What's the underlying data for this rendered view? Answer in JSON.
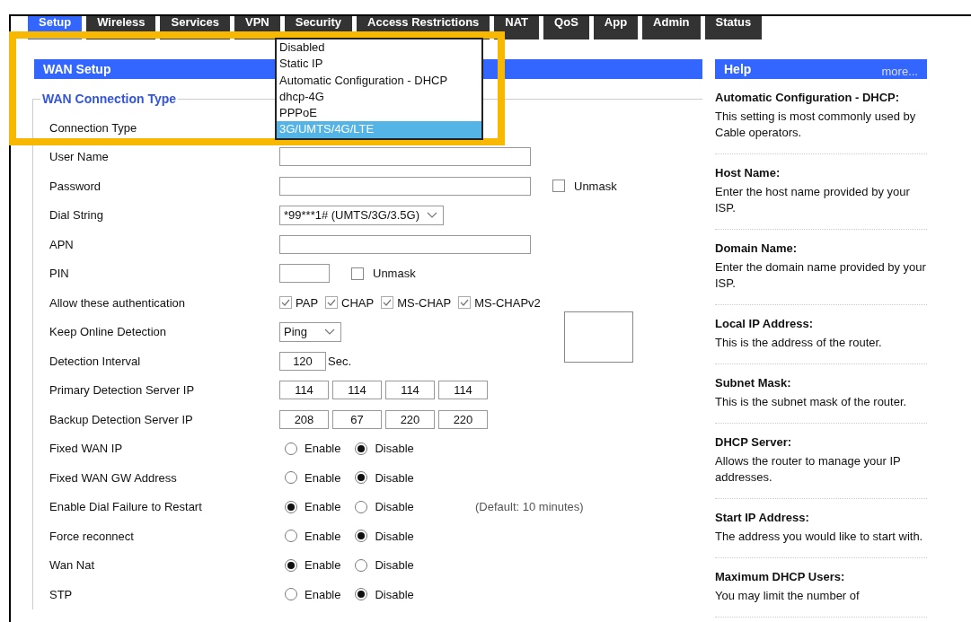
{
  "tabs": [
    {
      "label": "Setup",
      "selected": true
    },
    {
      "label": "Wireless",
      "selected": false
    },
    {
      "label": "Services",
      "selected": false
    },
    {
      "label": "VPN",
      "selected": false
    },
    {
      "label": "Security",
      "selected": false
    },
    {
      "label": "Access Restrictions",
      "selected": false
    },
    {
      "label": "NAT",
      "selected": false
    },
    {
      "label": "QoS",
      "selected": false
    },
    {
      "label": "App",
      "selected": false
    },
    {
      "label": "Admin",
      "selected": false
    },
    {
      "label": "Status",
      "selected": false
    }
  ],
  "wan_setup": {
    "title": "WAN Setup",
    "legend": "WAN Connection Type",
    "rows": [
      {
        "kind": "open-select",
        "label": "Connection Type"
      },
      {
        "kind": "text",
        "label": "User Name"
      },
      {
        "kind": "text",
        "label": "Password",
        "unmask": {
          "label": "Unmask",
          "checked": false
        }
      },
      {
        "kind": "select",
        "label": "Dial String",
        "value": "*99***1# (UMTS/3G/3.5G)"
      },
      {
        "kind": "text",
        "label": "APN"
      },
      {
        "kind": "short-text",
        "label": "PIN",
        "unmask": {
          "label": "Unmask",
          "checked": false
        }
      },
      {
        "kind": "checks",
        "label": "Allow these authentication",
        "options": [
          {
            "label": "PAP",
            "checked": true
          },
          {
            "label": "CHAP",
            "checked": true
          },
          {
            "label": "MS-CHAP",
            "checked": true
          },
          {
            "label": "MS-CHAPv2",
            "checked": true
          }
        ]
      },
      {
        "kind": "small-select",
        "label": "Keep Online Detection",
        "value": "Ping"
      },
      {
        "kind": "number",
        "label": "Detection Interval",
        "value": "120",
        "unit": "Sec."
      },
      {
        "kind": "ip",
        "label": "Primary Detection Server IP",
        "octets": [
          "114",
          "114",
          "114",
          "114"
        ]
      },
      {
        "kind": "ip",
        "label": "Backup Detection Server IP",
        "octets": [
          "208",
          "67",
          "220",
          "220"
        ]
      },
      {
        "kind": "radio",
        "label": "Fixed WAN IP",
        "options": [
          {
            "label": "Enable",
            "selected": false
          },
          {
            "label": "Disable",
            "selected": true
          }
        ]
      },
      {
        "kind": "radio",
        "label": "Fixed WAN GW Address",
        "options": [
          {
            "label": "Enable",
            "selected": false
          },
          {
            "label": "Disable",
            "selected": true
          }
        ]
      },
      {
        "kind": "radio",
        "label": "Enable Dial Failure to Restart",
        "options": [
          {
            "label": "Enable",
            "selected": true
          },
          {
            "label": "Disable",
            "selected": false
          }
        ],
        "note": "(Default: 10 minutes)"
      },
      {
        "kind": "radio",
        "label": "Force reconnect",
        "options": [
          {
            "label": "Enable",
            "selected": false
          },
          {
            "label": "Disable",
            "selected": true
          }
        ]
      },
      {
        "kind": "radio",
        "label": "Wan Nat",
        "options": [
          {
            "label": "Enable",
            "selected": true
          },
          {
            "label": "Disable",
            "selected": false
          }
        ]
      },
      {
        "kind": "radio",
        "label": "STP",
        "options": [
          {
            "label": "Enable",
            "selected": false
          },
          {
            "label": "Disable",
            "selected": true
          }
        ]
      }
    ]
  },
  "dropdown": {
    "options": [
      {
        "label": "Disabled",
        "selected": false
      },
      {
        "label": "Static IP",
        "selected": false
      },
      {
        "label": "Automatic Configuration - DHCP",
        "selected": false
      },
      {
        "label": "dhcp-4G",
        "selected": false
      },
      {
        "label": "PPPoE",
        "selected": false
      },
      {
        "label": "3G/UMTS/4G/LTE",
        "selected": true
      }
    ]
  },
  "help": {
    "title": "Help",
    "more": "more...",
    "items": [
      {
        "title": "Automatic Configuration - DHCP:",
        "text": "This setting is most commonly used by Cable operators."
      },
      {
        "title": "Host Name:",
        "text": "Enter the host name provided by your ISP."
      },
      {
        "title": "Domain Name:",
        "text": "Enter the domain name provided by your ISP."
      },
      {
        "title": "Local IP Address:",
        "text": "This is the address of the router."
      },
      {
        "title": "Subnet Mask:",
        "text": "This is the subnet mask of the router."
      },
      {
        "title": "DHCP Server:",
        "text": "Allows the router to manage your IP addresses."
      },
      {
        "title": "Start IP Address:",
        "text": "The address you would like to start with."
      },
      {
        "title": "Maximum DHCP Users:",
        "text": "You may limit the number of"
      }
    ]
  }
}
